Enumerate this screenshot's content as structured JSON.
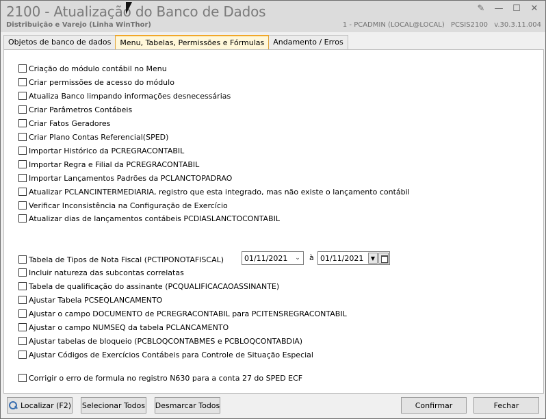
{
  "window": {
    "title": "2100 - Atualização do Banco de Dados",
    "subtitle": "Distribuição e Varejo (Linha WinThor)",
    "info": [
      "1 - PCADMIN (LOCAL@LOCAL)",
      "PCSIS2100",
      "v.30.3.11.004"
    ]
  },
  "tabs": [
    {
      "label": "Objetos de banco de dados"
    },
    {
      "label": "Menu, Tabelas, Permissões e Fórmulas"
    },
    {
      "label": "Andamento / Erros"
    }
  ],
  "options_group1": [
    {
      "label": "Criação do módulo contábil no Menu",
      "checked": false
    },
    {
      "label": "Criar permissões de acesso do módulo",
      "checked": false
    },
    {
      "label": "Atualiza Banco limpando informações desnecessárias",
      "checked": false
    },
    {
      "label": "Criar Parâmetros Contábeis",
      "checked": false
    },
    {
      "label": "Criar Fatos Geradores",
      "checked": false
    },
    {
      "label": "Criar Plano Contas Referencial(SPED)",
      "checked": false
    },
    {
      "label": "Importar Histórico da PCREGRACONTABIL",
      "checked": false
    },
    {
      "label": "Importar Regra e Filial da PCREGRACONTABIL",
      "checked": false
    },
    {
      "label": "Importar Lançamentos Padrões da PCLANCTOPADRAO",
      "checked": false
    },
    {
      "label": "Atualizar PCLANCINTERMEDIARIA, registro que esta integrado, mas não existe o lançamento contábil",
      "checked": false
    },
    {
      "label": "Verificar Inconsistência na Configuração de Exercício",
      "checked": false
    },
    {
      "label": "Atualizar dias de lançamentos contábeis PCDIASLANCTOCONTABIL",
      "checked": false
    }
  ],
  "options_group2": [
    {
      "label": "Tabela de Tipos de Nota Fiscal (PCTIPONOTAFISCAL)",
      "checked": false
    },
    {
      "label": "Incluir natureza das subcontas correlatas",
      "checked": false
    },
    {
      "label": "Tabela de qualificação do assinante (PCQUALIFICACAOASSINANTE)",
      "checked": false
    },
    {
      "label": "Ajustar Tabela PCSEQLANCAMENTO",
      "checked": false
    },
    {
      "label": "Ajustar o campo DOCUMENTO de PCREGRACONTABIL para PCITENSREGRACONTABIL",
      "checked": false
    },
    {
      "label": "Ajustar o campo NUMSEQ da tabela PCLANCAMENTO",
      "checked": false
    },
    {
      "label": "Ajustar tabelas de bloqueio (PCBLOQCONTABMES e PCBLOQCONTABDIA)",
      "checked": false
    },
    {
      "label": "Ajustar Códigos de Exercícios Contábeis para Controle de Situação Especial",
      "checked": false
    }
  ],
  "option_last": {
    "label": "Corrigir o erro de formula no registro N630 para a conta 27 do SPED ECF",
    "checked": false
  },
  "date_range": {
    "start": "01/11/2021",
    "separator": "à",
    "end": "01/11/2021"
  },
  "footer": {
    "localizar": "Localizar (F2)",
    "selecionar_todos": "Selecionar Todos",
    "desmarcar_todos": "Desmarcar Todos",
    "confirmar": "Confirmar",
    "fechar": "Fechar"
  }
}
